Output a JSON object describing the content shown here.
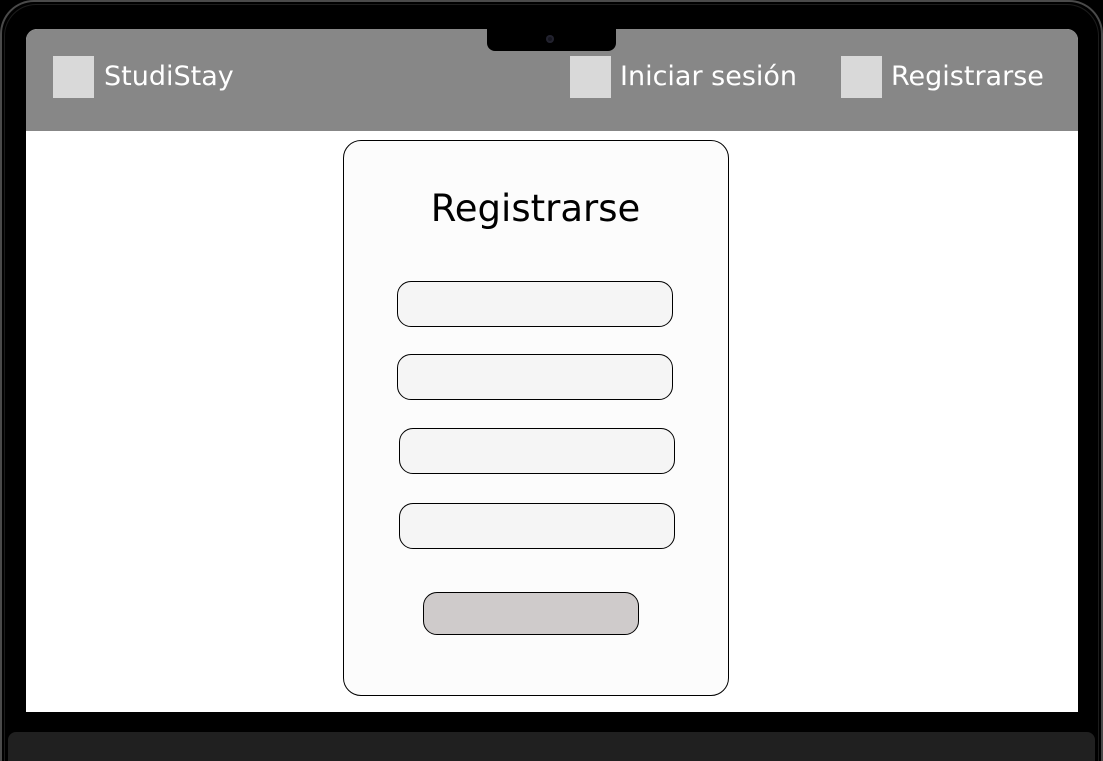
{
  "header": {
    "brand": "StudiStay",
    "login_label": "Iniciar sesión",
    "register_label": "Registrarse"
  },
  "register_form": {
    "title": "Registrarse",
    "fields": [
      {
        "value": "",
        "placeholder": ""
      },
      {
        "value": "",
        "placeholder": ""
      },
      {
        "value": "",
        "placeholder": ""
      },
      {
        "value": "",
        "placeholder": ""
      }
    ],
    "submit_label": ""
  },
  "colors": {
    "navbar_background": "#878787",
    "nav_icon_placeholder": "#d9d9d9",
    "card_background": "#fcfcfc",
    "field_background": "#f5f5f5",
    "submit_background": "#cfcbcb",
    "device_frame": "#000000"
  },
  "icons": {
    "brand": "image-placeholder-icon",
    "login": "image-placeholder-icon",
    "register": "image-placeholder-icon"
  }
}
